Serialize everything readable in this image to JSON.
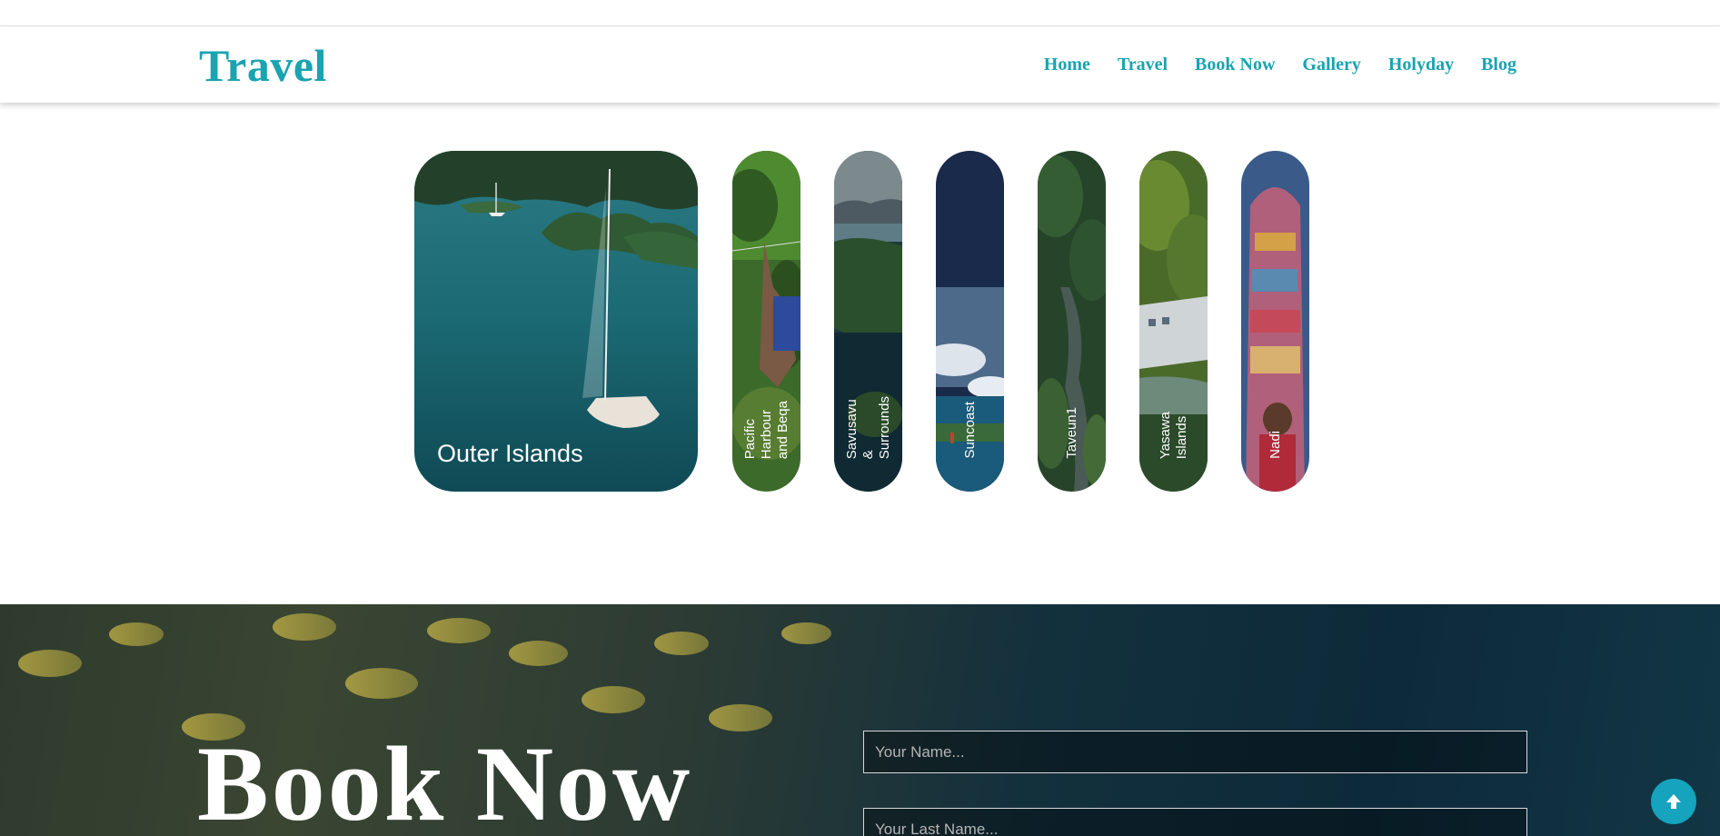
{
  "header": {
    "logo": "Travel",
    "nav": [
      "Home",
      "Travel",
      "Book Now",
      "Gallery",
      "Holyday",
      "Blog"
    ]
  },
  "destinations": [
    {
      "label": "Outer Islands",
      "expanded": true
    },
    {
      "label": "Pacific\nHarbour\nand Beqa",
      "expanded": false
    },
    {
      "label": "Savusavu\n&\nSurrounds",
      "expanded": false
    },
    {
      "label": "Suncoast",
      "expanded": false
    },
    {
      "label": "Taveun1",
      "expanded": false
    },
    {
      "label": "Yasawa\nIslands",
      "expanded": false
    },
    {
      "label": "Nadi",
      "expanded": false
    }
  ],
  "booking": {
    "title": "Book Now",
    "name_placeholder": "Your Name...",
    "last_name_placeholder": "Your Last Name..."
  },
  "scroll_top_icon": "arrow-up-icon",
  "colors": {
    "accent": "#1aa3b0",
    "scroll_button": "#15a3be"
  }
}
